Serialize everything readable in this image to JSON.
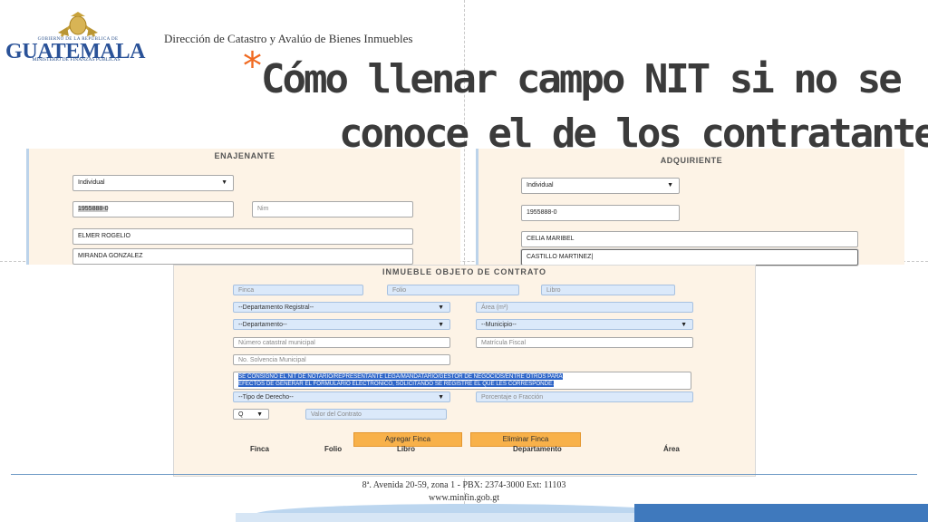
{
  "header": {
    "logo": {
      "gobierno": "GOBIERNO DE LA REPÚBLICA DE",
      "name": "GUATEMALA",
      "ministerio": "MINISTERIO DE FINANZAS PÚBLICAS"
    },
    "direccion": "Dirección de Catastro y Avalúo de Bienes Inmuebles"
  },
  "title": {
    "bullet": "*",
    "line1": "Cómo llenar campo NIT si no se",
    "line2": "conoce el de los contratantes"
  },
  "enajenante": {
    "heading": "ENAJENANTE",
    "tipo": "Individual",
    "nit": "1955888-0",
    "nim_placeholder": "Nim",
    "nombres": "ELMER ROGELIO",
    "apellidos": "MIRANDA GONZALEZ"
  },
  "adquiriente": {
    "heading": "ADQUIRIENTE",
    "tipo": "Individual",
    "nit": "1955888-0",
    "nombres": "CELIA MARIBEL",
    "apellidos": "CASTILLO MARTINEZ"
  },
  "inmueble": {
    "heading": "INMUEBLE OBJETO DE CONTRATO",
    "finca_ph": "Finca",
    "folio_ph": "Folio",
    "libro_ph": "Libro",
    "depto_registral": "--Departamento Registral--",
    "area_ph": "Área (m²)",
    "departamento": "--Departamento--",
    "municipio": "--Municipio--",
    "numero_catastral_ph": "Número catastral municipal",
    "matricula_fiscal_ph": "Matrícula Fiscal",
    "solvencia_ph": "No. Solvencia Municipal",
    "observacion_line1": "SE CONSIGNO EL NIT DE NOTARIO/REPRESENTANTE LEGA/MANDATARIO/GESTOR DE NEGOCIOS/ENTRE OTROS PARA",
    "observacion_line2": "EFECTOS DE GENERAR EL FORMULARIO ELECTRÓNICO, SOLICITANDO SE REGISTRE EL QUE LES CORRESPONDE.",
    "tipo_derecho": "--Tipo de Derecho--",
    "porcentaje_ph": "Porcentaje o Fracción",
    "moneda": "Q",
    "valor_ph": "Valor del Contrato",
    "agregar_label": "Agregar Finca",
    "eliminar_label": "Eliminar Finca",
    "columns": [
      "Finca",
      "Folio",
      "Libro",
      "Departamento",
      "Área"
    ]
  },
  "footer": {
    "address": "8ª. Avenida 20-59, zona 1 -  PBX: 2374-3000  Ext: 11103",
    "web": "www.minfin.gob.gt"
  },
  "colors": {
    "accent_orange": "#f06a21",
    "brand_blue": "#2a5298",
    "button_orange": "#f8b14a",
    "field_blue": "#dbe9fa",
    "panel_bg": "#fdf3e6"
  }
}
